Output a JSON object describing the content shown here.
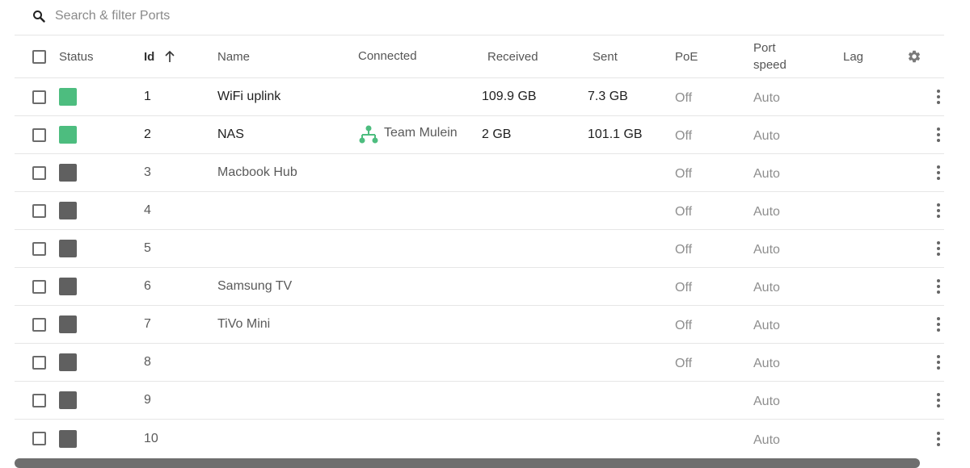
{
  "search": {
    "placeholder": "Search & filter Ports"
  },
  "columns": {
    "status": "Status",
    "id": "Id",
    "name": "Name",
    "connected": "Connected",
    "received": "Received",
    "sent": "Sent",
    "poe": "PoE",
    "speed_line1": "Port",
    "speed_line2": "speed",
    "lag": "Lag"
  },
  "colors": {
    "status_up": "#4dbd7f",
    "status_down": "#606060",
    "connected_icon": "#4dbd7f"
  },
  "rows": [
    {
      "id": "1",
      "status": "up",
      "name": "WiFi uplink",
      "connected": "",
      "received": "109.9 GB",
      "sent": "7.3 GB",
      "poe": "Off",
      "speed": "Auto"
    },
    {
      "id": "2",
      "status": "up",
      "name": "NAS",
      "connected": "Team Mulein",
      "received": "2 GB",
      "sent": "101.1 GB",
      "poe": "Off",
      "speed": "Auto"
    },
    {
      "id": "3",
      "status": "down",
      "name": "Macbook Hub",
      "connected": "",
      "received": "",
      "sent": "",
      "poe": "Off",
      "speed": "Auto"
    },
    {
      "id": "4",
      "status": "down",
      "name": "",
      "connected": "",
      "received": "",
      "sent": "",
      "poe": "Off",
      "speed": "Auto"
    },
    {
      "id": "5",
      "status": "down",
      "name": "",
      "connected": "",
      "received": "",
      "sent": "",
      "poe": "Off",
      "speed": "Auto"
    },
    {
      "id": "6",
      "status": "down",
      "name": "Samsung TV",
      "connected": "",
      "received": "",
      "sent": "",
      "poe": "Off",
      "speed": "Auto"
    },
    {
      "id": "7",
      "status": "down",
      "name": "TiVo Mini",
      "connected": "",
      "received": "",
      "sent": "",
      "poe": "Off",
      "speed": "Auto"
    },
    {
      "id": "8",
      "status": "down",
      "name": "",
      "connected": "",
      "received": "",
      "sent": "",
      "poe": "Off",
      "speed": "Auto"
    },
    {
      "id": "9",
      "status": "down",
      "name": "",
      "connected": "",
      "received": "",
      "sent": "",
      "poe": "",
      "speed": "Auto"
    },
    {
      "id": "10",
      "status": "down",
      "name": "",
      "connected": "",
      "received": "",
      "sent": "",
      "poe": "",
      "speed": "Auto"
    }
  ]
}
